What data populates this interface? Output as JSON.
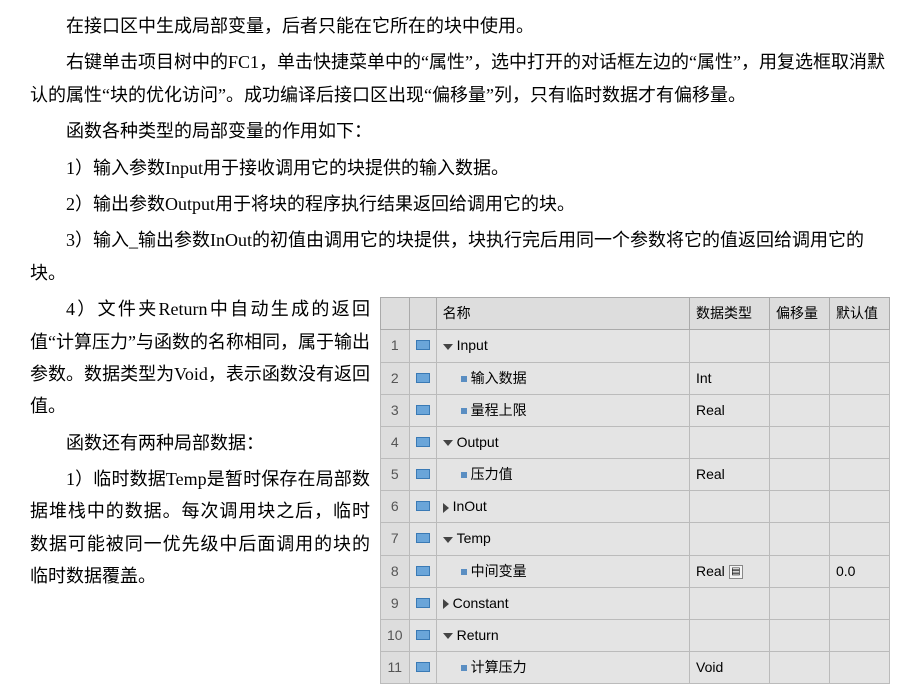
{
  "paragraphs_top": [
    "在接口区中生成局部变量，后者只能在它所在的块中使用。",
    "右键单击项目树中的FC1，单击快捷菜单中的“属性”，选中打开的对话框左边的“属性”，用复选框取消默认的属性“块的优化访问”。成功编译后接口区出现“偏移量”列，只有临时数据才有偏移量。",
    "函数各种类型的局部变量的作用如下：",
    "1）输入参数Input用于接收调用它的块提供的输入数据。",
    "2）输出参数Output用于将块的程序执行结果返回给调用它的块。",
    "3）输入_输出参数InOut的初值由调用它的块提供，块执行完后用同一个参数将它的值返回给调用它的块。"
  ],
  "paragraphs_left": [
    "4）文件夹Return中自动生成的返回值“计算压力”与函数的名称相同，属于输出参数。数据类型为Void，表示函数没有返回值。",
    "函数还有两种局部数据：",
    "1）临时数据Temp是暂时保存在局部数据堆栈中的数据。每次调用块之后，临时数据可能被同一优先级中后面调用的块的临时数据覆盖。"
  ],
  "table": {
    "headers": [
      "",
      "",
      "名称",
      "数据类型",
      "偏移量",
      "默认值"
    ],
    "rows": [
      {
        "num": "1",
        "kind": "section",
        "arrow": "down",
        "indent": 0,
        "name": "Input",
        "type": "",
        "offset": "",
        "default": ""
      },
      {
        "num": "2",
        "kind": "item",
        "indent": 1,
        "name": "输入数据",
        "type": "Int",
        "offset": "",
        "default": ""
      },
      {
        "num": "3",
        "kind": "item",
        "indent": 1,
        "name": "量程上限",
        "type": "Real",
        "offset": "",
        "default": ""
      },
      {
        "num": "4",
        "kind": "section",
        "arrow": "down",
        "indent": 0,
        "name": "Output",
        "type": "",
        "offset": "",
        "default": ""
      },
      {
        "num": "5",
        "kind": "item",
        "indent": 1,
        "name": "压力值",
        "type": "Real",
        "offset": "",
        "default": ""
      },
      {
        "num": "6",
        "kind": "section",
        "arrow": "right",
        "indent": 0,
        "name": "InOut",
        "type": "",
        "offset": "",
        "default": ""
      },
      {
        "num": "7",
        "kind": "section",
        "arrow": "down",
        "indent": 0,
        "name": "Temp",
        "type": "",
        "offset": "",
        "default": ""
      },
      {
        "num": "8",
        "kind": "item",
        "indent": 1,
        "name": "中间变量",
        "type": "Real",
        "offset": "",
        "default": "0.0",
        "has_mini": true
      },
      {
        "num": "9",
        "kind": "section",
        "arrow": "right",
        "indent": 0,
        "name": "Constant",
        "type": "",
        "offset": "",
        "default": ""
      },
      {
        "num": "10",
        "kind": "section",
        "arrow": "down",
        "indent": 0,
        "name": "Return",
        "type": "",
        "offset": "",
        "default": ""
      },
      {
        "num": "11",
        "kind": "item",
        "indent": 1,
        "name": "计算压力",
        "type": "Void",
        "offset": "",
        "default": ""
      }
    ]
  }
}
